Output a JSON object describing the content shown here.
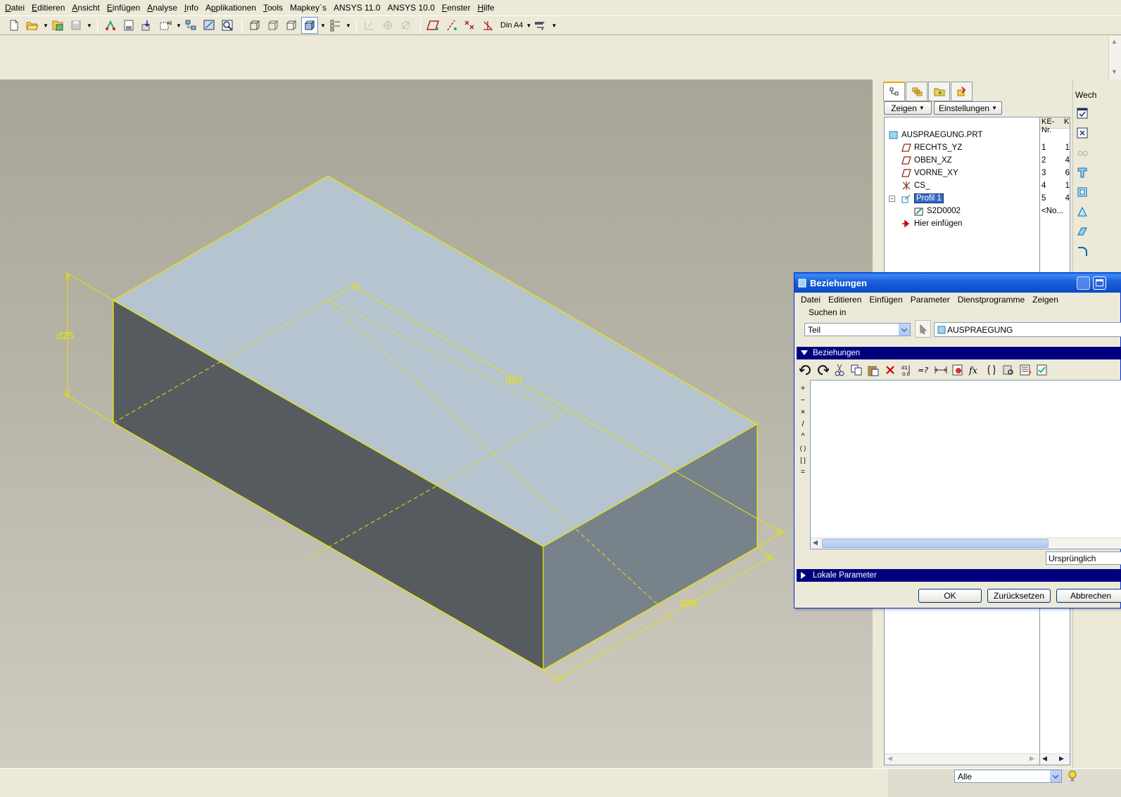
{
  "menubar": {
    "items": [
      {
        "pre": "",
        "mn": "D",
        "post": "atei"
      },
      {
        "pre": "",
        "mn": "E",
        "post": "ditieren"
      },
      {
        "pre": "",
        "mn": "A",
        "post": "nsicht"
      },
      {
        "pre": "",
        "mn": "E",
        "post": "infügen"
      },
      {
        "pre": "",
        "mn": "A",
        "post": "nalyse"
      },
      {
        "pre": "",
        "mn": "I",
        "post": "nfo"
      },
      {
        "pre": "A",
        "mn": "p",
        "post": "plikationen"
      },
      {
        "pre": "",
        "mn": "T",
        "post": "ools"
      },
      {
        "pre": "Mapkey´s",
        "mn": "",
        "post": ""
      },
      {
        "pre": "ANSYS 11.0",
        "mn": "",
        "post": ""
      },
      {
        "pre": "ANSYS 10.0",
        "mn": "",
        "post": ""
      },
      {
        "pre": "",
        "mn": "F",
        "post": "enster"
      },
      {
        "pre": "",
        "mn": "H",
        "post": "ilfe"
      }
    ]
  },
  "toolbar": {
    "sheet_size": "Din A4"
  },
  "model": {
    "dimensions": {
      "height": "d25",
      "length": "d27",
      "width": "d26"
    }
  },
  "model_tree": {
    "show_button": "Zeigen",
    "settings_button": "Einstellungen",
    "column_ke": "KE-Nr.",
    "column_extra": "K",
    "root": "AUSPRAEGUNG.PRT",
    "items": [
      {
        "label": "RECHTS_YZ",
        "ke": "1",
        "extra": "1"
      },
      {
        "label": "OBEN_XZ",
        "ke": "2",
        "extra": "4"
      },
      {
        "label": "VORNE_XY",
        "ke": "3",
        "extra": "6"
      },
      {
        "label": "CS_",
        "ke": "4",
        "extra": "1"
      },
      {
        "label": "Profil 1",
        "ke": "5",
        "extra": "4"
      },
      {
        "label": "S2D0002",
        "ke": "<No...",
        "extra": ""
      }
    ],
    "insert_here": "Hier einfügen",
    "filter": "Alle"
  },
  "right_toolbar": {
    "label": "Wech"
  },
  "dialog": {
    "title": "Beziehungen",
    "menu": [
      "Datei",
      "Editieren",
      "Einfügen",
      "Parameter",
      "Dienstprogramme",
      "Zeigen"
    ],
    "search_label": "Suchen in",
    "search_type": "Teil",
    "search_object": "AUSPRAEGUNG",
    "relations_header": "Beziehungen",
    "operators": [
      "+",
      "−",
      "×",
      "/",
      "^",
      "( )",
      "[ ]",
      "="
    ],
    "sort_option": "Ursprünglich",
    "local_params_header": "Lokale Parameter",
    "ok": "OK",
    "reset": "Zurücksetzen",
    "cancel": "Abbrechen"
  }
}
